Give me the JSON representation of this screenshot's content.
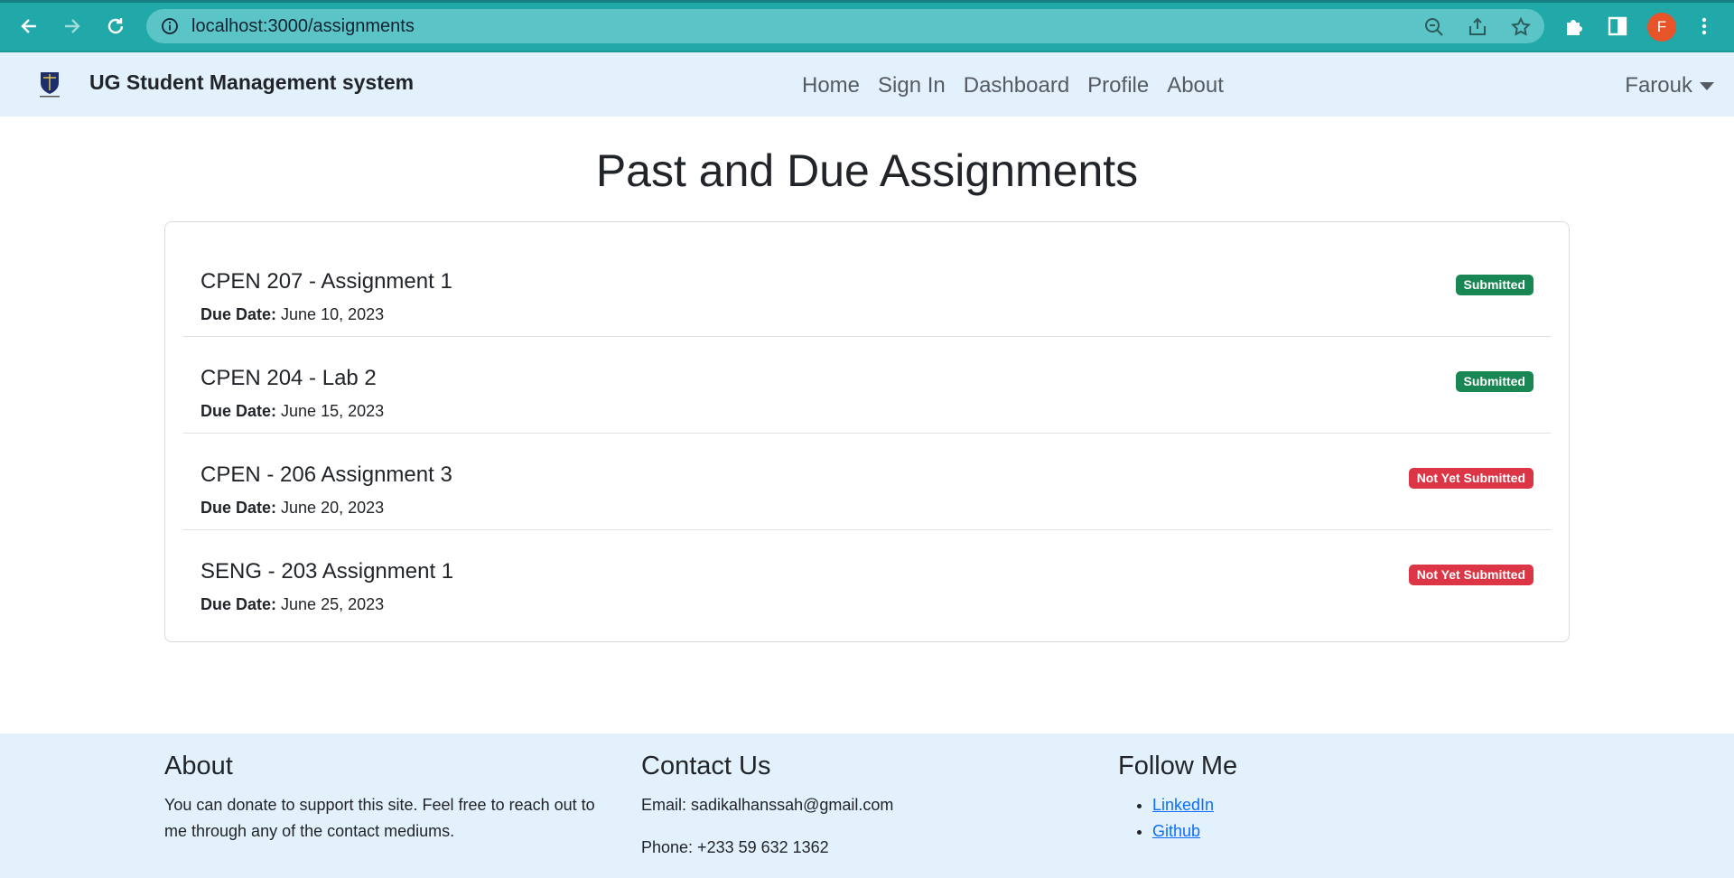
{
  "browser": {
    "url": "localhost:3000/assignments",
    "profile_initial": "F",
    "theme_color": "#21a8a8"
  },
  "navbar": {
    "brand": "UG Student Management system",
    "links": [
      "Home",
      "Sign In",
      "Dashboard",
      "Profile",
      "About"
    ],
    "user": "Farouk"
  },
  "page": {
    "title": "Past and Due Assignments"
  },
  "assignments": [
    {
      "title": "CPEN 207 - Assignment 1",
      "due_label": "Due Date:",
      "due": "June 10, 2023",
      "status": "Submitted",
      "status_color": "#198754"
    },
    {
      "title": "CPEN 204 - Lab 2",
      "due_label": "Due Date:",
      "due": "June 15, 2023",
      "status": "Submitted",
      "status_color": "#198754"
    },
    {
      "title": "CPEN - 206 Assignment 3",
      "due_label": "Due Date:",
      "due": "June 20, 2023",
      "status": "Not Yet Submitted",
      "status_color": "#dc3545"
    },
    {
      "title": "SENG - 203 Assignment 1",
      "due_label": "Due Date:",
      "due": "June 25, 2023",
      "status": "Not Yet Submitted",
      "status_color": "#dc3545"
    }
  ],
  "footer": {
    "about": {
      "heading": "About",
      "text": "You can donate to support this site. Feel free to reach out to me through any of the contact mediums."
    },
    "contact": {
      "heading": "Contact Us",
      "email": "Email: sadikalhanssah@gmail.com",
      "phone": "Phone: +233 59 632 1362"
    },
    "follow": {
      "heading": "Follow Me",
      "links": [
        "LinkedIn",
        "Github"
      ]
    }
  }
}
